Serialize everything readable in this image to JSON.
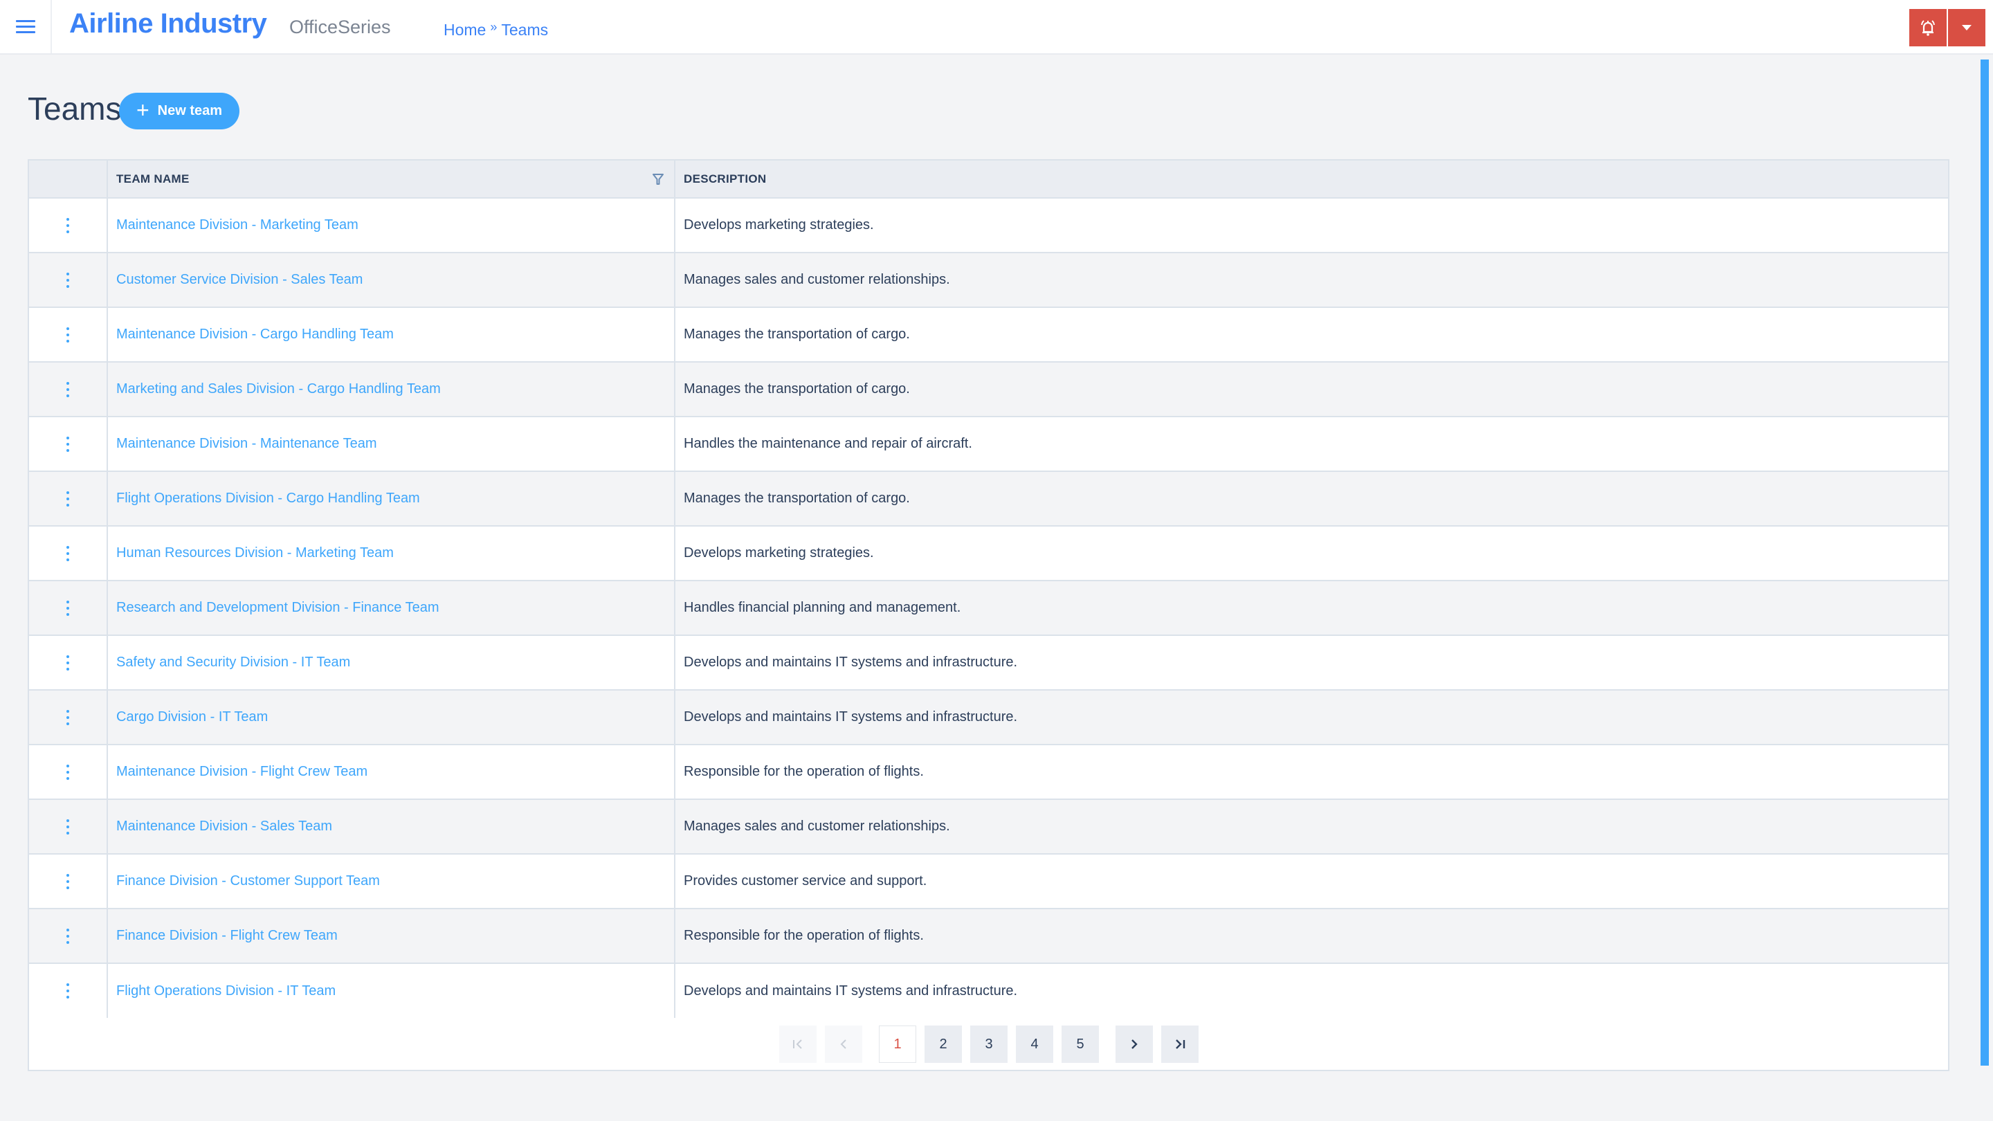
{
  "header": {
    "app_title": "Airline Industry",
    "app_subtitle": "OfficeSeries",
    "breadcrumb": [
      {
        "label": "Home"
      },
      {
        "label": "Teams"
      }
    ],
    "breadcrumb_separator": "»",
    "icons": {
      "menu": "hamburger-menu-icon",
      "notifications": "bell-ringing-icon",
      "dropdown": "caret-down-icon"
    }
  },
  "page": {
    "title": "Teams",
    "new_button_label": "New team",
    "new_button_icon": "+"
  },
  "table": {
    "columns": [
      {
        "key": "actions",
        "label": ""
      },
      {
        "key": "team_name",
        "label": "TEAM NAME",
        "filterable": true
      },
      {
        "key": "description",
        "label": "DESCRIPTION"
      }
    ],
    "rows": [
      {
        "team_name": "Maintenance Division - Marketing Team",
        "description": "Develops marketing strategies."
      },
      {
        "team_name": "Customer Service Division - Sales Team",
        "description": "Manages sales and customer relationships."
      },
      {
        "team_name": "Maintenance Division - Cargo Handling Team",
        "description": "Manages the transportation of cargo."
      },
      {
        "team_name": "Marketing and Sales Division - Cargo Handling Team",
        "description": "Manages the transportation of cargo."
      },
      {
        "team_name": "Maintenance Division - Maintenance Team",
        "description": "Handles the maintenance and repair of aircraft."
      },
      {
        "team_name": "Flight Operations Division - Cargo Handling Team",
        "description": "Manages the transportation of cargo."
      },
      {
        "team_name": "Human Resources Division - Marketing Team",
        "description": "Develops marketing strategies."
      },
      {
        "team_name": "Research and Development Division - Finance Team",
        "description": "Handles financial planning and management."
      },
      {
        "team_name": "Safety and Security Division - IT Team",
        "description": "Develops and maintains IT systems and infrastructure."
      },
      {
        "team_name": "Cargo Division - IT Team",
        "description": "Develops and maintains IT systems and infrastructure."
      },
      {
        "team_name": "Maintenance Division - Flight Crew Team",
        "description": "Responsible for the operation of flights."
      },
      {
        "team_name": "Maintenance Division - Sales Team",
        "description": "Manages sales and customer relationships."
      },
      {
        "team_name": "Finance Division - Customer Support Team",
        "description": "Provides customer service and support."
      },
      {
        "team_name": "Finance Division - Flight Crew Team",
        "description": "Responsible for the operation of flights."
      },
      {
        "team_name": "Flight Operations Division - IT Team",
        "description": "Develops and maintains IT systems and infrastructure."
      }
    ]
  },
  "pagination": {
    "current_page": 1,
    "pages": [
      "1",
      "2",
      "3",
      "4",
      "5"
    ],
    "first_disabled": true,
    "prev_disabled": true
  },
  "colors": {
    "accent": "#3b82f6",
    "link": "#3ea6fb",
    "danger": "#d94f43",
    "text": "#2c3e5a"
  }
}
